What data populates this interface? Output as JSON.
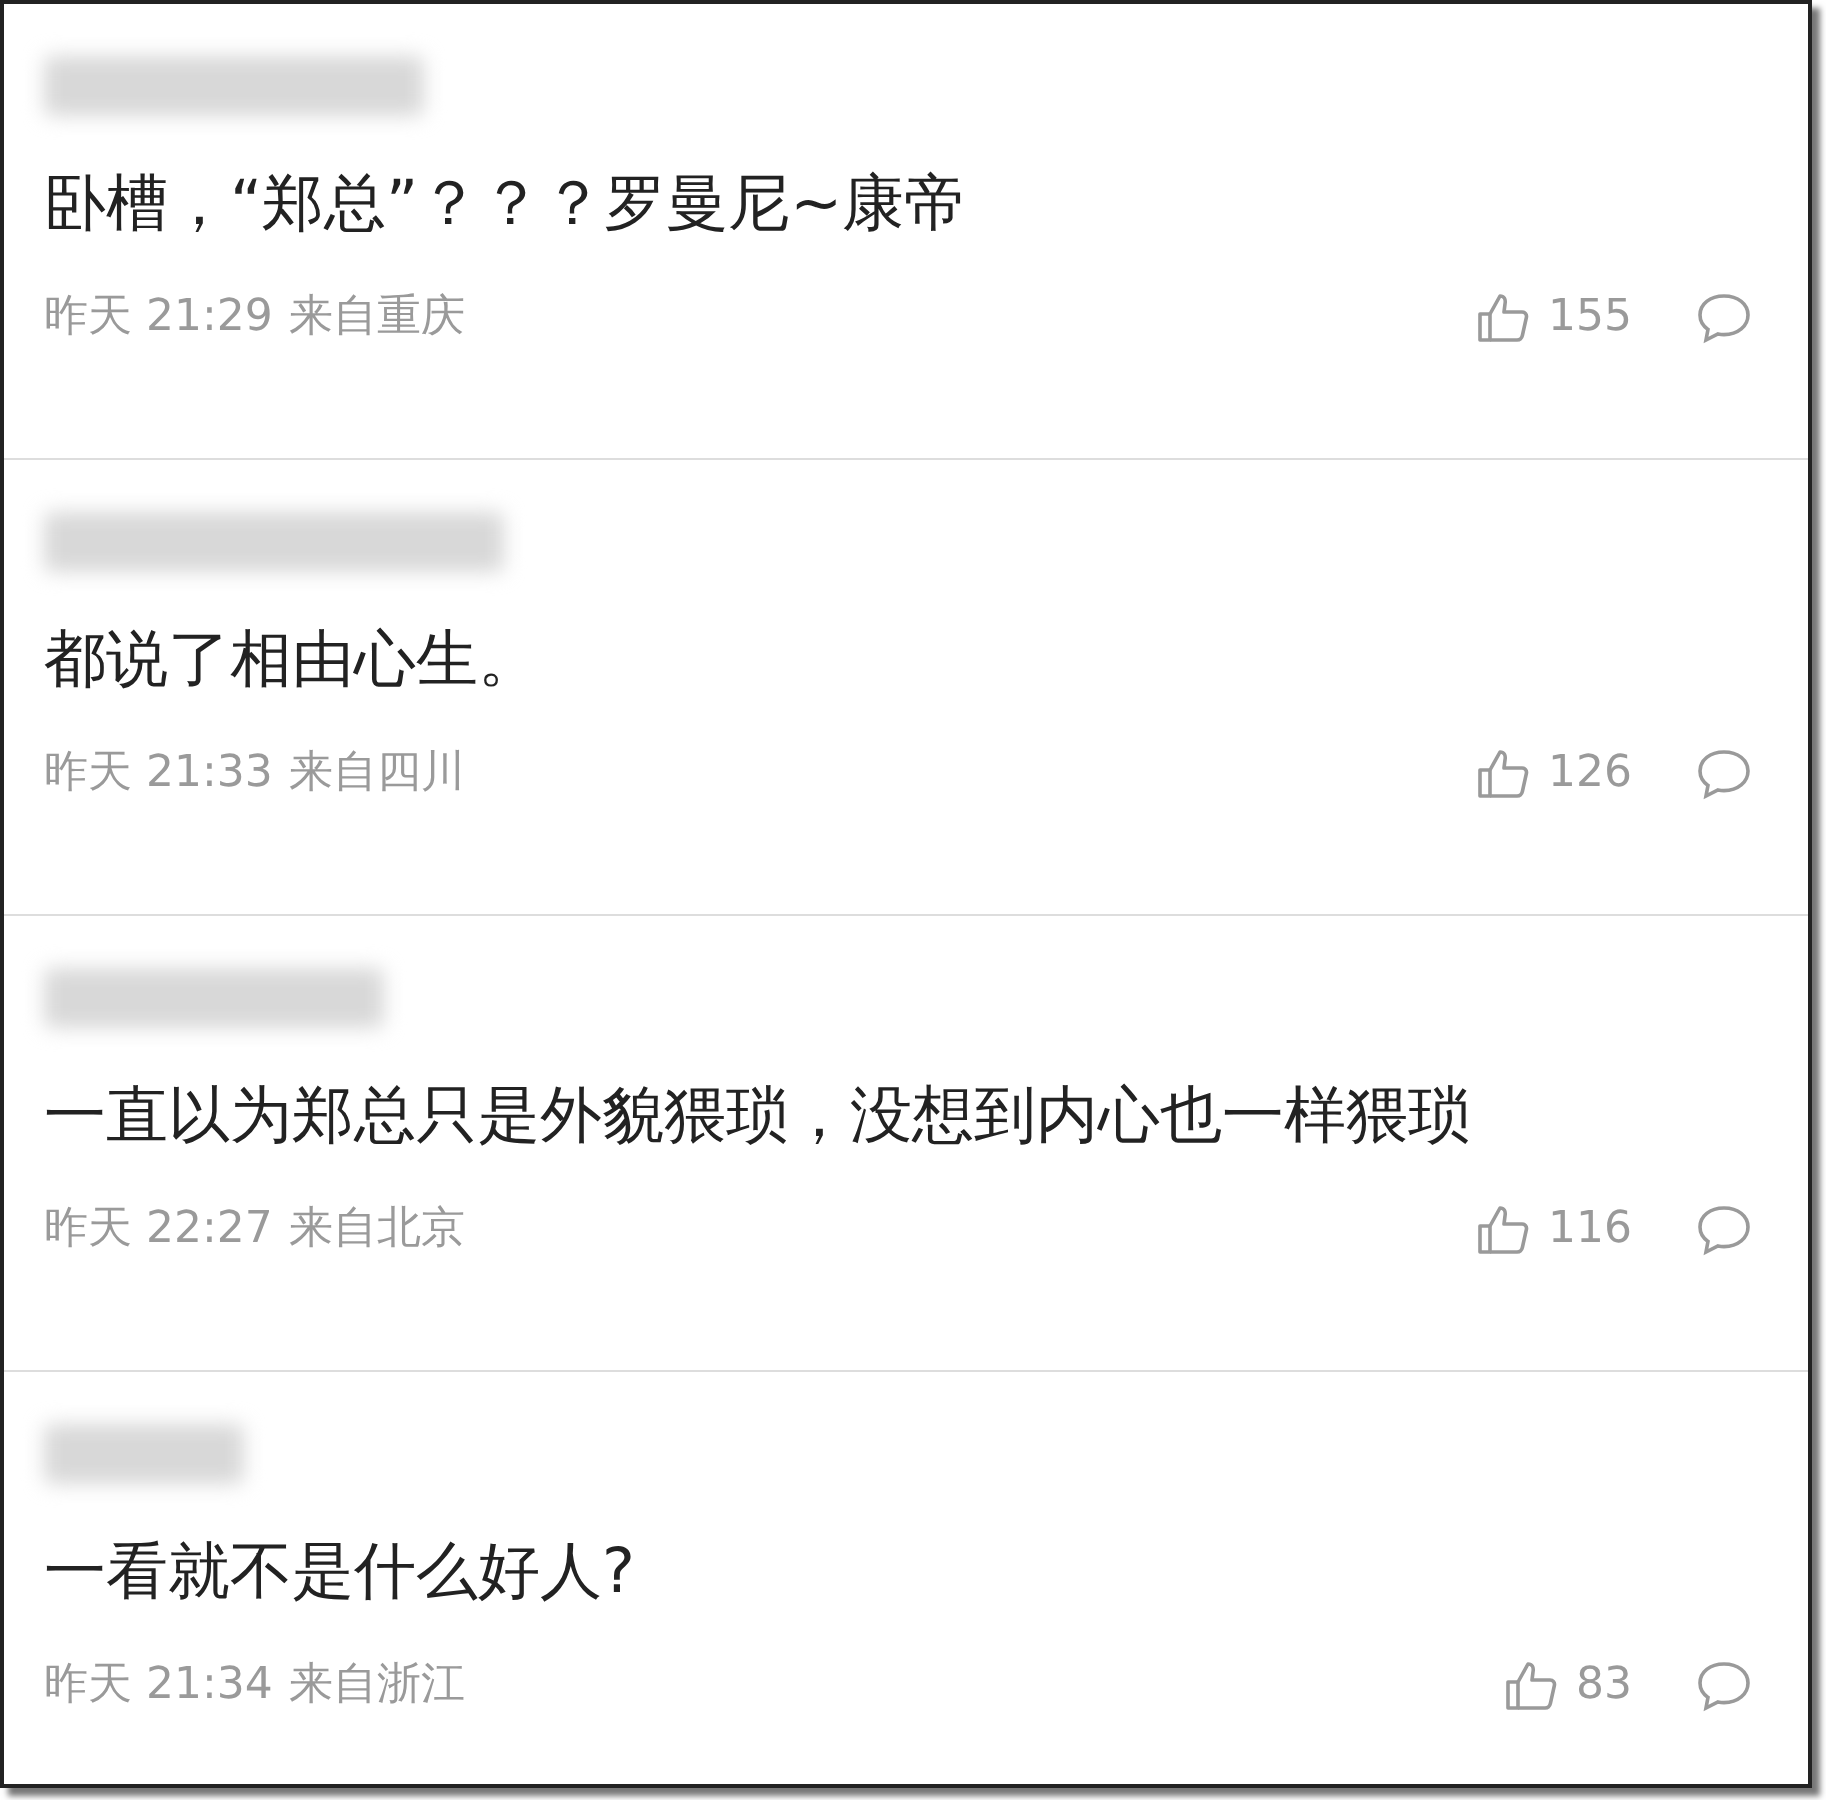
{
  "comments": [
    {
      "text": "卧槽，“郑总”？？？罗曼尼~康帝",
      "time": "昨天 21:29",
      "location": "来自重庆",
      "likes": "155"
    },
    {
      "text": "都说了相由心生。",
      "time": "昨天 21:33",
      "location": "来自四川",
      "likes": "126"
    },
    {
      "text": "一直以为郑总只是外貌猥琐，没想到内心也一样猥琐",
      "time": "昨天 22:27",
      "location": "来自北京",
      "likes": "116"
    },
    {
      "text": "一看就不是什么好人?",
      "time": "昨天 21:34",
      "location": "来自浙江",
      "likes": "83"
    }
  ]
}
